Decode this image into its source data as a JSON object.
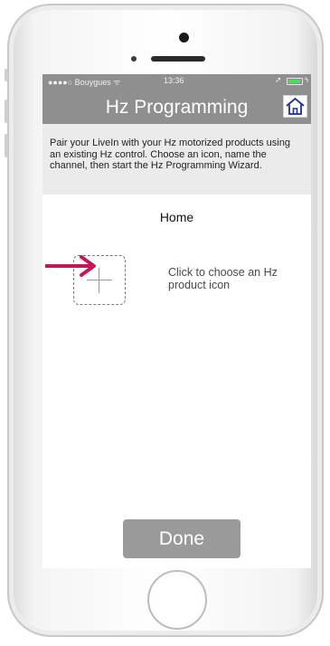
{
  "status_bar": {
    "carrier": "●●●●○ Bouygues ᯤ",
    "time": "13:36",
    "battery_level": 0.9
  },
  "nav": {
    "title": "Hz Programming",
    "home_icon": "home-icon"
  },
  "intro_text": "Pair your LiveIn with your Hz motorized products using an existing Hz control. Choose an icon, name the channel, then start the Hz Programming Wizard.",
  "room_name": "Home",
  "product_icon": {
    "icon": "plus-icon",
    "hint": "Click to choose an Hz product icon"
  },
  "done_label": "Done",
  "colors": {
    "bar": "#8f8f8f",
    "intro_bg": "#ebebeb",
    "button": "#9a9a9a",
    "annotation_arrow": "#c2185b"
  }
}
